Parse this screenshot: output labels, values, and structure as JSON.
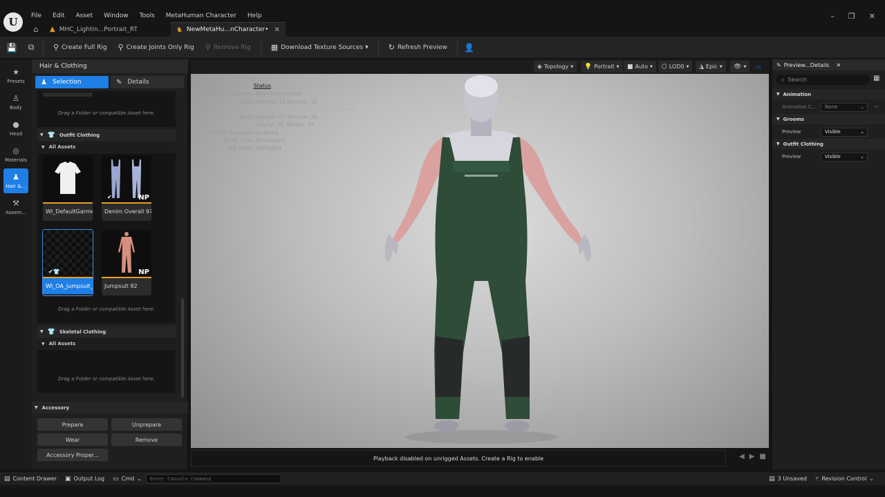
{
  "menu": [
    "File",
    "Edit",
    "Asset",
    "Window",
    "Tools",
    "MetaHuman Character",
    "Help"
  ],
  "tabs": [
    {
      "label": "MHC_Lightin...Portrait_RT",
      "active": false
    },
    {
      "label": "NewMetaHu...nCharacter•",
      "active": true
    }
  ],
  "toolbar": {
    "create_full_rig": "Create Full Rig",
    "create_joints_only_rig": "Create Joints Only Rig",
    "remove_rig": "Remove Rig",
    "download_texture_sources": "Download Texture Sources",
    "refresh_preview": "Refresh Preview"
  },
  "rail": [
    {
      "label": "Presets",
      "icon": "star-icon"
    },
    {
      "label": "Body",
      "icon": "body-icon"
    },
    {
      "label": "Head",
      "icon": "head-icon"
    },
    {
      "label": "Materials",
      "icon": "materials-icon"
    },
    {
      "label": "Hair &...",
      "icon": "hair-icon",
      "active": true
    },
    {
      "label": "Assem...",
      "icon": "hammer-icon"
    }
  ],
  "panel": {
    "title": "Hair & Clothing",
    "tab_selection": "Selection",
    "tab_details": "Details",
    "drop_hint": "Drag a Folder or compatible Asset here.",
    "outfit_section": "Outfit Clothing",
    "all_assets": "All Assets",
    "skeletal_section": "Skeletal Clothing",
    "assets": [
      {
        "label": "WI_DefaultGarment"
      },
      {
        "label": "Denim Overall 97",
        "badge": "NP"
      },
      {
        "label": "WI_OA_jumpsuit_...",
        "selected": true
      },
      {
        "label": "Jumpsuit 82",
        "badge": "NP"
      }
    ],
    "accessory_section": "Accessory",
    "prepare": "Prepare",
    "unprepare": "Unprepare",
    "wear": "Wear",
    "remove": "Remove",
    "accessory_properties": "Accessory Proper..."
  },
  "viewport": {
    "topology": "Topology",
    "portrait": "Portrait",
    "auto": "Auto",
    "lod": "LOD0",
    "quality": "Epic",
    "status_title": "Status",
    "stats": [
      {
        "key": "Texture Sources:",
        "value": "Needs download"
      },
      {
        "key": "Face:",
        "value": "Albedo: 1k Normal: 1k"
      },
      {
        "key": "",
        "value": "Cavity 1k, Anim. Maps: Unavailable"
      },
      {
        "key": "Body:",
        "value": "Albedo: 2k Normal: 2k"
      },
      {
        "key": "",
        "value": "Cavity: 2k, Masks: 1k"
      },
      {
        "key": "Virtual Textures:",
        "value": "Enabled"
      },
      {
        "key": "Body Type:",
        "value": "Parametric"
      },
      {
        "key": "Rig State:",
        "value": "Unrigged"
      }
    ],
    "bottom_message": "Playback disabled on unrigged Assets. Create a Rig to enable"
  },
  "details": {
    "title": "Preview...Details",
    "search_placeholder": "Search",
    "animation": "Animation",
    "animation_key": "Animation C...",
    "animation_value": "None",
    "grooms": "Grooms",
    "grooms_key": "Preview",
    "grooms_value": "Visible",
    "outfit": "Outfit Clothing",
    "outfit_key": "Preview",
    "outfit_value": "Visible"
  },
  "statusbar": {
    "content_drawer": "Content Drawer",
    "output_log": "Output Log",
    "cmd": "Cmd",
    "console_placeholder": "Enter Console Command",
    "unsaved": "3 Unsaved",
    "revision_control": "Revision Control"
  }
}
